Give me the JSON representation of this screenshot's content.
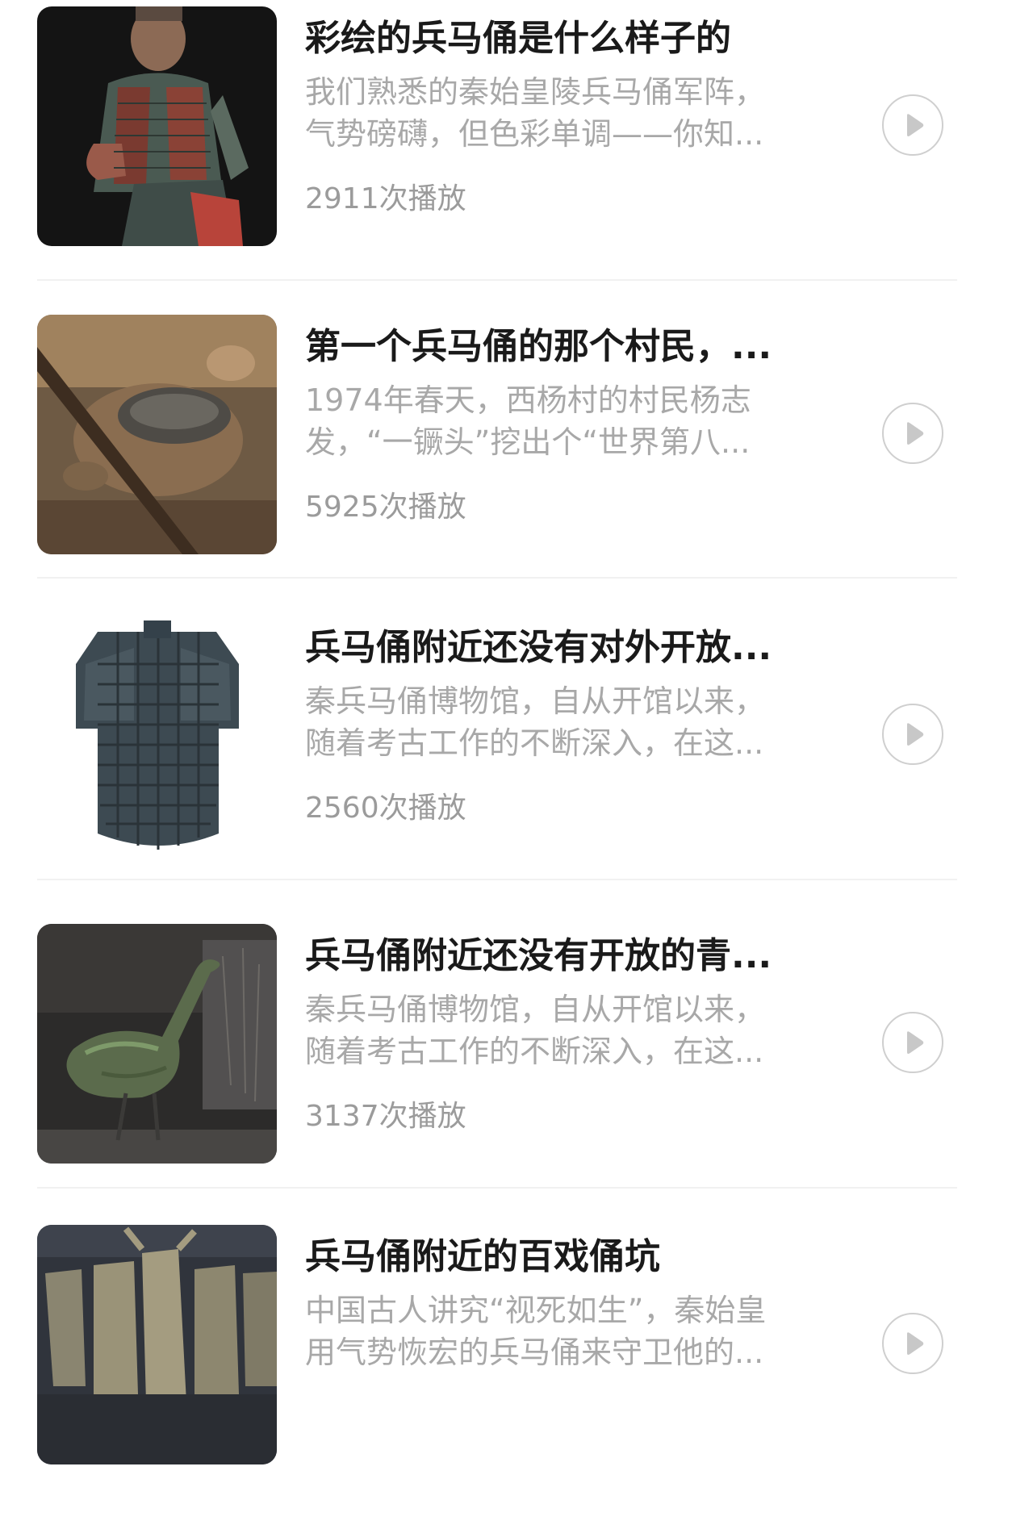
{
  "items": [
    {
      "thumbnail_icon": "painted-terracotta-warrior-image",
      "title": "彩绘的兵马俑是什么样子的",
      "desc_line1": "我们熟悉的秦始皇陵兵马俑军阵，",
      "desc_line2": "气势磅礴，但色彩单调——你知...",
      "plays": "2911次播放"
    },
    {
      "thumbnail_icon": "excavation-site-image",
      "title": "第一个兵马俑的那个村民，...",
      "desc_line1": "1974年春天，西杨村的村民杨志",
      "desc_line2": "发，“一镢头”挖出个“世界第八...",
      "plays": "5925次播放"
    },
    {
      "thumbnail_icon": "stone-armor-image",
      "title": "兵马俑附近还没有对外开放...",
      "desc_line1": "秦兵马俑博物馆，自从开馆以来，",
      "desc_line2": "随着考古工作的不断深入，在这...",
      "plays": "2560次播放"
    },
    {
      "thumbnail_icon": "bronze-crane-image",
      "title": "兵马俑附近还没有开放的青...",
      "desc_line1": "秦兵马俑博物馆，自从开馆以来，",
      "desc_line2": "随着考古工作的不断深入，在这...",
      "plays": "3137次播放"
    },
    {
      "thumbnail_icon": "acrobat-figurines-image",
      "title": "兵马俑附近的百戏俑坑",
      "desc_line1": "中国古人讲究“视死如生”，秦始皇",
      "desc_line2": "用气势恢宏的兵马俑来守卫他的...",
      "plays": ""
    }
  ],
  "colors": {
    "title": "#1a1a1a",
    "description": "#a8a8a8",
    "play_count": "#9b9b9b",
    "divider": "#f1f1f1",
    "play_button_border": "#cfcfcf",
    "play_button_icon": "#c8c8c8"
  }
}
